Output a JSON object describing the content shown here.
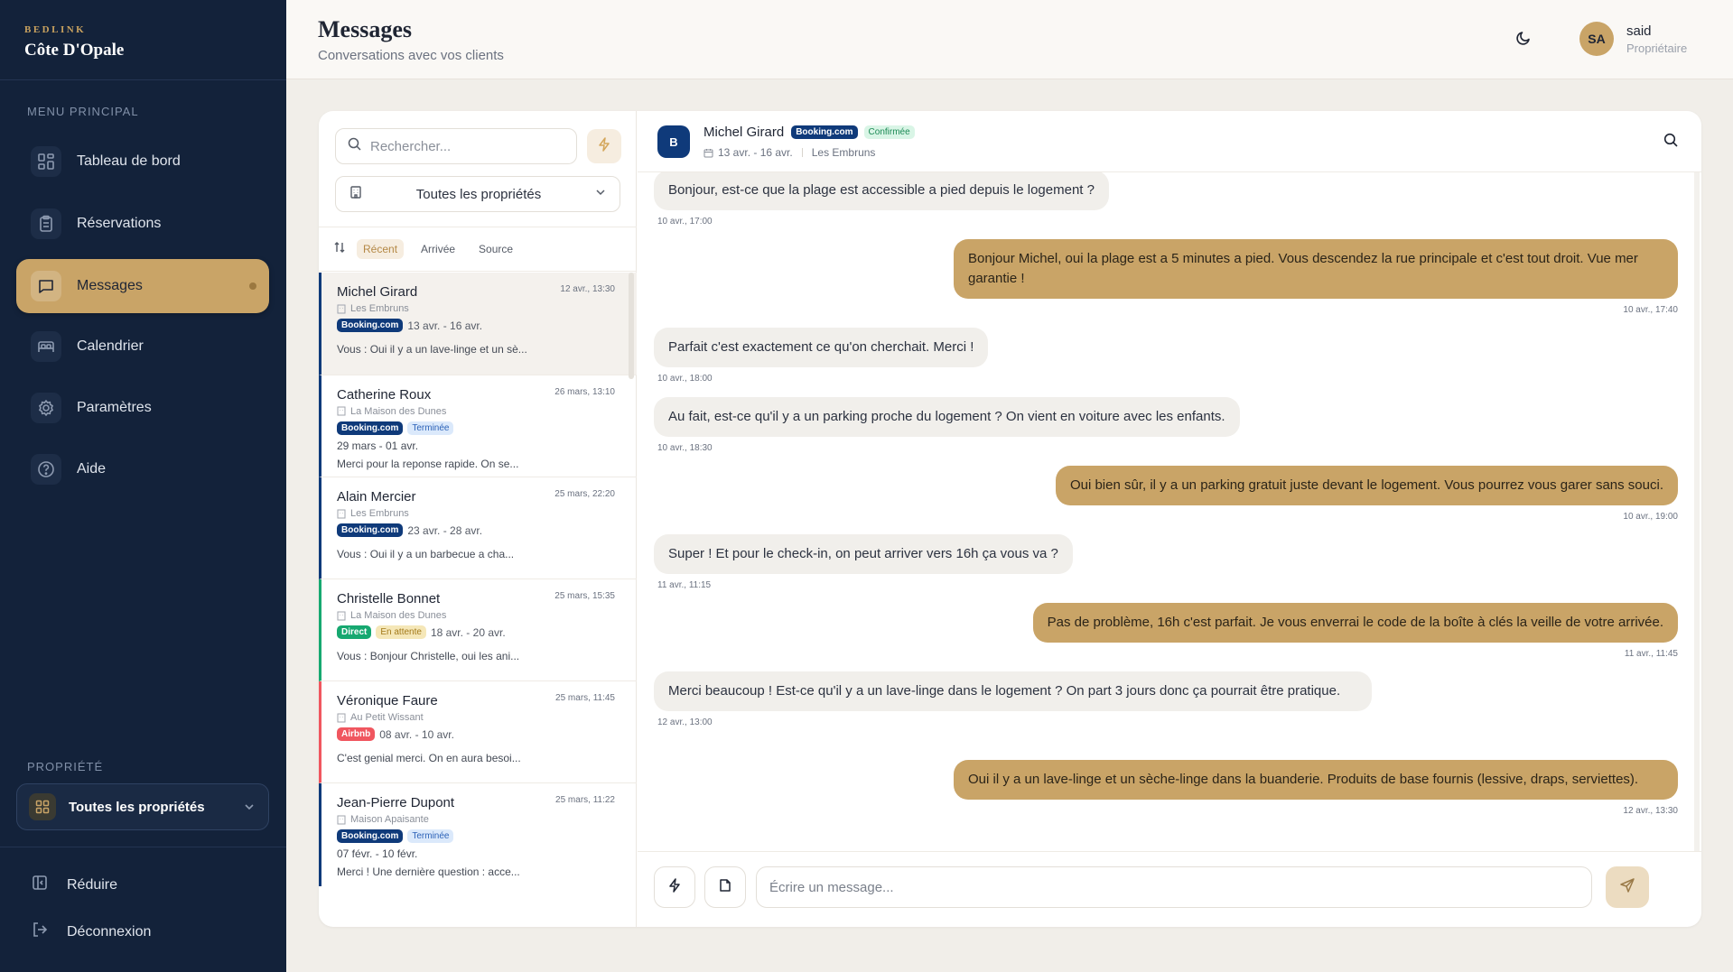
{
  "sidebar": {
    "brand_top": "BEDLINK",
    "brand_name": "Côte D'Opale",
    "menu_title": "MENU PRINCIPAL",
    "items": [
      {
        "label": "Tableau de bord",
        "icon": "dashboard-icon"
      },
      {
        "label": "Réservations",
        "icon": "clipboard-icon"
      },
      {
        "label": "Messages",
        "icon": "message-icon",
        "active": true
      },
      {
        "label": "Calendrier",
        "icon": "bed-icon"
      },
      {
        "label": "Paramètres",
        "icon": "gear-icon"
      },
      {
        "label": "Aide",
        "icon": "help-icon"
      }
    ],
    "property_title": "PROPRIÉTÉ",
    "property_select": "Toutes les propriétés",
    "collapse_label": "Réduire",
    "logout_label": "Déconnexion"
  },
  "header": {
    "title": "Messages",
    "subtitle": "Conversations avec vos clients",
    "user_initials": "SA",
    "user_name": "said",
    "user_role": "Propriétaire"
  },
  "list": {
    "search_placeholder": "Rechercher...",
    "filter_label": "Toutes les propriétés",
    "sort_tabs": [
      "Récent",
      "Arrivée",
      "Source"
    ],
    "conversations": [
      {
        "name": "Michel Girard",
        "time": "12 avr., 13:30",
        "property": "Les Embruns",
        "source": "Booking.com",
        "status": "",
        "dates": "13 avr. - 16 avr.",
        "preview": "Vous : Oui il y a un lave-linge et un sè..."
      },
      {
        "name": "Catherine Roux",
        "time": "26 mars, 13:10",
        "property": "La Maison des Dunes",
        "source": "Booking.com",
        "status": "Terminée",
        "dates": "29 mars - 01 avr.",
        "preview": "Merci pour la reponse rapide. On se..."
      },
      {
        "name": "Alain Mercier",
        "time": "25 mars, 22:20",
        "property": "Les Embruns",
        "source": "Booking.com",
        "status": "",
        "dates": "23 avr. - 28 avr.",
        "preview": "Vous : Oui il y a un barbecue a cha..."
      },
      {
        "name": "Christelle Bonnet",
        "time": "25 mars, 15:35",
        "property": "La Maison des Dunes",
        "source": "Direct",
        "status": "En attente",
        "dates": "18 avr. - 20 avr.",
        "preview": "Vous : Bonjour Christelle, oui les ani..."
      },
      {
        "name": "Véronique Faure",
        "time": "25 mars, 11:45",
        "property": "Au Petit Wissant",
        "source": "Airbnb",
        "status": "",
        "dates": "08 avr. - 10 avr.",
        "preview": "C'est genial merci. On en aura besoi..."
      },
      {
        "name": "Jean-Pierre Dupont",
        "time": "25 mars, 11:22",
        "property": "Maison Apaisante",
        "source": "Booking.com",
        "status": "Terminée",
        "dates": "07 févr. - 10 févr.",
        "preview": "Merci ! Une dernière question : acce..."
      }
    ]
  },
  "chat": {
    "avatar": "B",
    "name": "Michel Girard",
    "source": "Booking.com",
    "status": "Confirmée",
    "dates": "13 avr. - 16 avr.",
    "property": "Les Embruns",
    "messages": [
      {
        "dir": "in",
        "text": "Bonjour, est-ce que la plage est accessible a pied depuis le logement ?",
        "time": "10 avr., 17:00"
      },
      {
        "dir": "out",
        "text": "Bonjour Michel, oui la plage est a 5 minutes a pied. Vous descendez la rue principale et c'est tout droit. Vue mer garantie !",
        "time": "10 avr., 17:40"
      },
      {
        "dir": "in",
        "text": "Parfait c'est exactement ce qu'on cherchait. Merci !",
        "time": "10 avr., 18:00"
      },
      {
        "dir": "in",
        "text": "Au fait, est-ce qu'il y a un parking proche du logement ? On vient en voiture avec les enfants.",
        "time": "10 avr., 18:30"
      },
      {
        "dir": "out",
        "text": "Oui bien sûr, il y a un parking gratuit juste devant le logement. Vous pourrez vous garer sans souci.",
        "time": "10 avr., 19:00"
      },
      {
        "dir": "in",
        "text": "Super ! Et pour le check-in, on peut arriver vers 16h ça vous va ?",
        "time": "11 avr., 11:15"
      },
      {
        "dir": "out",
        "text": "Pas de problème, 16h c'est parfait. Je vous enverrai le code de la boîte à clés la veille de votre arrivée.",
        "time": "11 avr., 11:45"
      },
      {
        "dir": "in",
        "text": "Merci beaucoup ! Est-ce qu'il y a un lave-linge dans le logement ? On part 3 jours donc ça pourrait être pratique.",
        "time": "12 avr., 13:00"
      },
      {
        "dir": "out",
        "text": "Oui il y a un lave-linge et un sèche-linge dans la buanderie. Produits de base fournis (lessive, draps, serviettes).",
        "time": "12 avr., 13:30"
      }
    ],
    "composer_placeholder": "Écrire un message..."
  },
  "colors": {
    "sidebar_bg": "#13223a",
    "accent": "#c9a467",
    "booking": "#0f3a7a",
    "direct": "#16a870",
    "airbnb": "#f0565f",
    "pending": "#f5e7b8",
    "finished": "#dbe9fb",
    "confirmed": "#d9f5e6"
  }
}
